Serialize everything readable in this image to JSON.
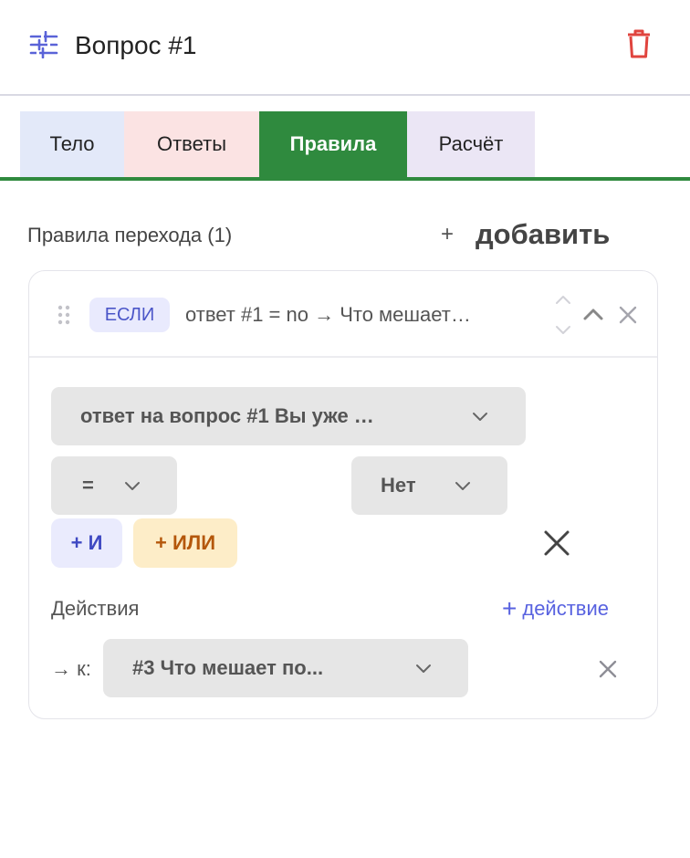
{
  "header": {
    "title": "Вопрос #1",
    "settings_icon": "sliders-icon",
    "delete_icon": "trash-icon",
    "delete_color": "#e0443e"
  },
  "tabs": [
    {
      "label": "Тело",
      "color": "#e3e9f9"
    },
    {
      "label": "Ответы",
      "color": "#fbe3e3"
    },
    {
      "label": "Правила",
      "color": "#2f8a3e",
      "active": true
    },
    {
      "label": "Расчёт",
      "color": "#ebe6f5"
    }
  ],
  "rules_section": {
    "title": "Правила перехода (1)",
    "add_plus": "+",
    "add_label": "добавить"
  },
  "rule": {
    "if_badge": "ЕСЛИ",
    "summary": "ответ #1 = no  →  Что мешает…",
    "condition": {
      "question_select": "ответ на вопрос #1 Вы уже …",
      "operator_select": "=",
      "value_select": "Нет"
    },
    "and_button": "+ И",
    "or_button": "+ ИЛИ",
    "actions": {
      "label": "Действия",
      "add_plus": "+",
      "add_label": "действие",
      "goto_prefix": "→ к:",
      "goto_select": "#3 Что мешает по..."
    }
  }
}
